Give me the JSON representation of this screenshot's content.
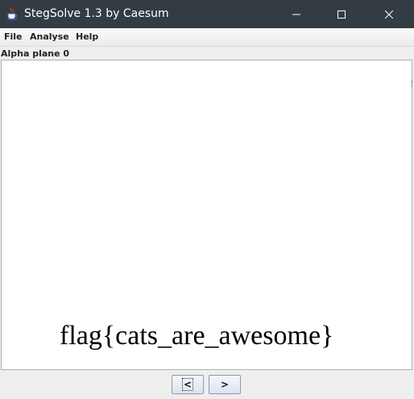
{
  "window": {
    "title": "StegSolve 1.3 by Caesum",
    "icon": "java-cup-icon",
    "controls": [
      "minimize-icon",
      "maximize-icon",
      "close-icon"
    ]
  },
  "menubar": {
    "items": [
      {
        "label": "File"
      },
      {
        "label": "Analyse"
      },
      {
        "label": "Help"
      }
    ]
  },
  "panel": {
    "label": "Alpha plane 0"
  },
  "image": {
    "text": "flag{cats_are_awesome}"
  },
  "navigation": {
    "prev_label": "<",
    "next_label": ">"
  },
  "colors": {
    "titlebar": "#333c43",
    "window_bg": "#eeeeee",
    "canvas_bg": "#ffffff",
    "button_border": "#8a9ab0"
  }
}
